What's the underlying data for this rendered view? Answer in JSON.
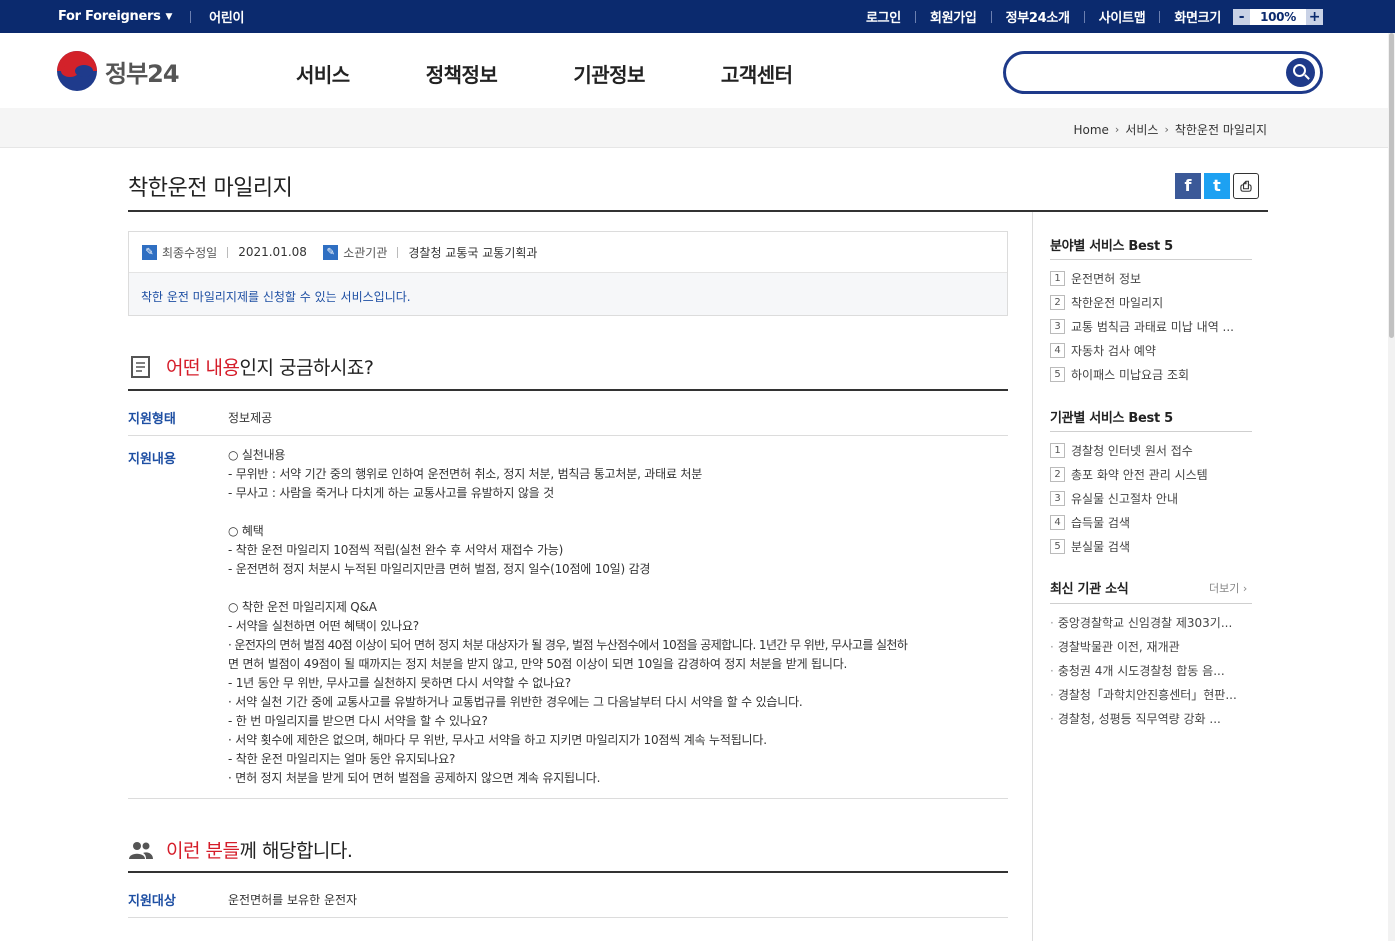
{
  "topbar": {
    "for_foreigners": "For Foreigners",
    "kids": "어린이",
    "links": [
      "로그인",
      "회원가입",
      "정부24소개",
      "사이트맵"
    ],
    "zoom_label": "화면크기",
    "zoom_minus": "-",
    "zoom_value": "100%",
    "zoom_plus": "+"
  },
  "header": {
    "logo_text": "정부24",
    "nav": [
      "서비스",
      "정책정보",
      "기관정보",
      "고객센터"
    ],
    "search_placeholder": ""
  },
  "breadcrumb": [
    "Home",
    "서비스",
    "착한운전 마일리지"
  ],
  "page": {
    "title": "착한운전 마일리지",
    "share": {
      "facebook": "f",
      "twitter": "t",
      "print": "⎙"
    }
  },
  "info": {
    "updated_label": "최종수정일",
    "updated_value": "2021.01.08",
    "agency_label": "소관기관",
    "agency_value": "경찰청 교통국 교통기획과",
    "description": "착한 운전 마일리지제를 신청할 수 있는 서비스입니다."
  },
  "section1": {
    "title_red": "어떤 내용",
    "title_rest": "인지 궁금하시죠?",
    "support_type_label": "지원형태",
    "support_type_value": "정보제공",
    "support_content_label": "지원내용",
    "lines": [
      "○ 실천내용",
      " - 무위반 : 서약 기간 중의 행위로 인하여 운전면허 취소, 정지 처분, 범칙금 통고처분, 과태료 처분",
      " - 무사고 : 사람을 죽거나 다치게 하는 교통사고를 유발하지 않을 것",
      "",
      "○ 혜택",
      " - 착한 운전 마일리지 10점씩 적립(실천 완수 후 서약서 재접수 가능)",
      " - 운전면허 정지 처분시 누적된 마일리지만큼 면허 벌점, 정지 일수(10점에 10일) 감경",
      "",
      "○ 착한 운전 마일리지제 Q&A",
      " - 서약을 실천하면 어떤 혜택이 있나요?",
      "  · 운전자의 면허 벌점 40점 이상이 되어 면허 정지 처분 대상자가 될 경우, 벌점 누산점수에서 10점을 공제합니다. 1년간 무 위반, 무사고를 실천하",
      "면 면허 벌점이 49점이 될 때까지는 정지 처분을 받지 않고, 만약 50점 이상이 되면 10일을 감경하여 정지 처분을 받게 됩니다.",
      " - 1년 동안 무 위반, 무사고를 실천하지 못하면 다시 서약할 수 없나요?",
      "  · 서약 실천 기간 중에 교통사고를 유발하거나 교통법규를 위반한 경우에는 그 다음날부터 다시 서약을 할 수 있습니다.",
      " - 한 번 마일리지를 받으면 다시 서약을 할 수 있나요?",
      "  · 서약 횟수에 제한은 없으며, 해마다 무 위반, 무사고 서약을 하고 지키면 마일리지가 10점씩 계속 누적됩니다.",
      " - 착한 운전 마일리지는 얼마 동안 유지되나요?",
      "  · 면허 정지 처분을 받게 되어 면허 벌점을 공제하지 않으면 계속 유지됩니다."
    ]
  },
  "section2": {
    "title_red": "이런 분들",
    "title_rest": "께 해당합니다.",
    "target_label": "지원대상",
    "target_value": "운전면허를 보유한 운전자"
  },
  "sidebar": {
    "field_best_title": "분야별 서비스 Best 5",
    "field_best": [
      "운전면허 정보",
      "착한운전 마일리지",
      "교통 범칙금 과태료 미납 내역 ...",
      "자동차 검사 예약",
      "하이패스 미납요금 조회"
    ],
    "org_best_title": "기관별 서비스 Best 5",
    "org_best": [
      "경찰청 인터넷 원서 접수",
      "총포 화약 안전 관리 시스템",
      "유실물 신고절차 안내",
      "습득물 검색",
      "분실물 검색"
    ],
    "news_title": "최신 기관 소식",
    "news_more": "더보기 ›",
    "news": [
      "중앙경찰학교 신임경찰 제303기...",
      "경찰박물관 이전, 재개관",
      "충청권 4개 시도경찰청 합동 음...",
      "경찰청「과학치안진흥센터」현판...",
      "경찰청, 성평등 직무역량 강화 ..."
    ]
  },
  "numbers": [
    "1",
    "2",
    "3",
    "4",
    "5"
  ]
}
